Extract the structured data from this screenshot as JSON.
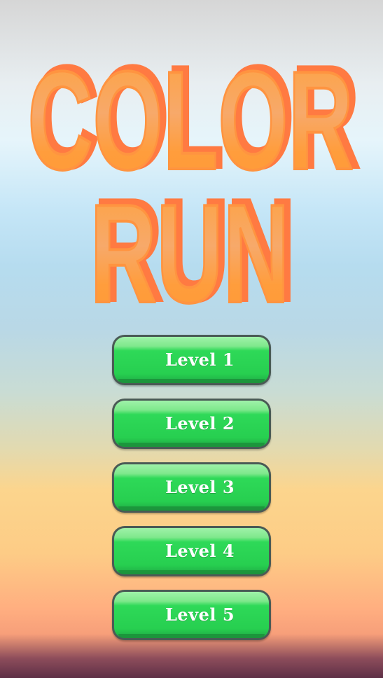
{
  "title": {
    "line1": "COLOR",
    "line2": "RUN"
  },
  "colors": {
    "title_fill_top": "#ff9f35",
    "title_fill_mid": "#f9a562",
    "title_shadow": "#ff7a42",
    "button_green": "#2ed958",
    "button_border": "#4a5a55"
  },
  "levels": [
    {
      "label": "Level 1"
    },
    {
      "label": "Level 2"
    },
    {
      "label": "Level 3"
    },
    {
      "label": "Level 4"
    },
    {
      "label": "Level 5"
    }
  ]
}
